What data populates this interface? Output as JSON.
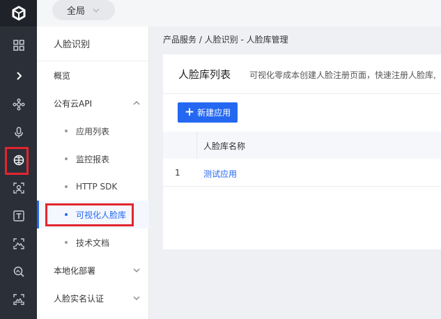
{
  "topbar": {
    "scope_label": "全局"
  },
  "rail": {
    "items": [
      {
        "icon": "grid-icon"
      },
      {
        "icon": "chevron-right-icon"
      },
      {
        "icon": "network-icon"
      },
      {
        "icon": "microphone-icon"
      },
      {
        "icon": "globe-icon",
        "highlighted": true
      },
      {
        "icon": "face-scan-icon"
      },
      {
        "icon": "text-recognition-icon"
      },
      {
        "icon": "mountain-scan-icon"
      },
      {
        "icon": "image-search-icon"
      },
      {
        "icon": "landscape-scan-icon"
      }
    ]
  },
  "sidebar": {
    "title": "人脸识别",
    "items": [
      {
        "label": "概览"
      },
      {
        "label": "公有云API",
        "expanded": true
      },
      {
        "label": "应用列表"
      },
      {
        "label": "监控报表"
      },
      {
        "label": "HTTP SDK"
      },
      {
        "label": "可视化人脸库",
        "active": true
      },
      {
        "label": "技术文档"
      },
      {
        "label": "本地化部署",
        "expanded": false
      },
      {
        "label": "人脸实名认证",
        "expanded": false
      }
    ]
  },
  "breadcrumb": "产品服务 / 人脸识别 - 人脸库管理",
  "main": {
    "title": "人脸库列表",
    "description": "可视化零成本创建人脸注册页面，快速注册人脸库,",
    "new_button_label": "新建应用",
    "table": {
      "columns": [
        "",
        "人脸库名称"
      ],
      "rows": [
        {
          "index": "1",
          "name": "测试应用"
        }
      ]
    }
  },
  "colors": {
    "accent": "#2468f2",
    "highlight": "#e3252e",
    "rail_bg": "#2b2f38"
  }
}
